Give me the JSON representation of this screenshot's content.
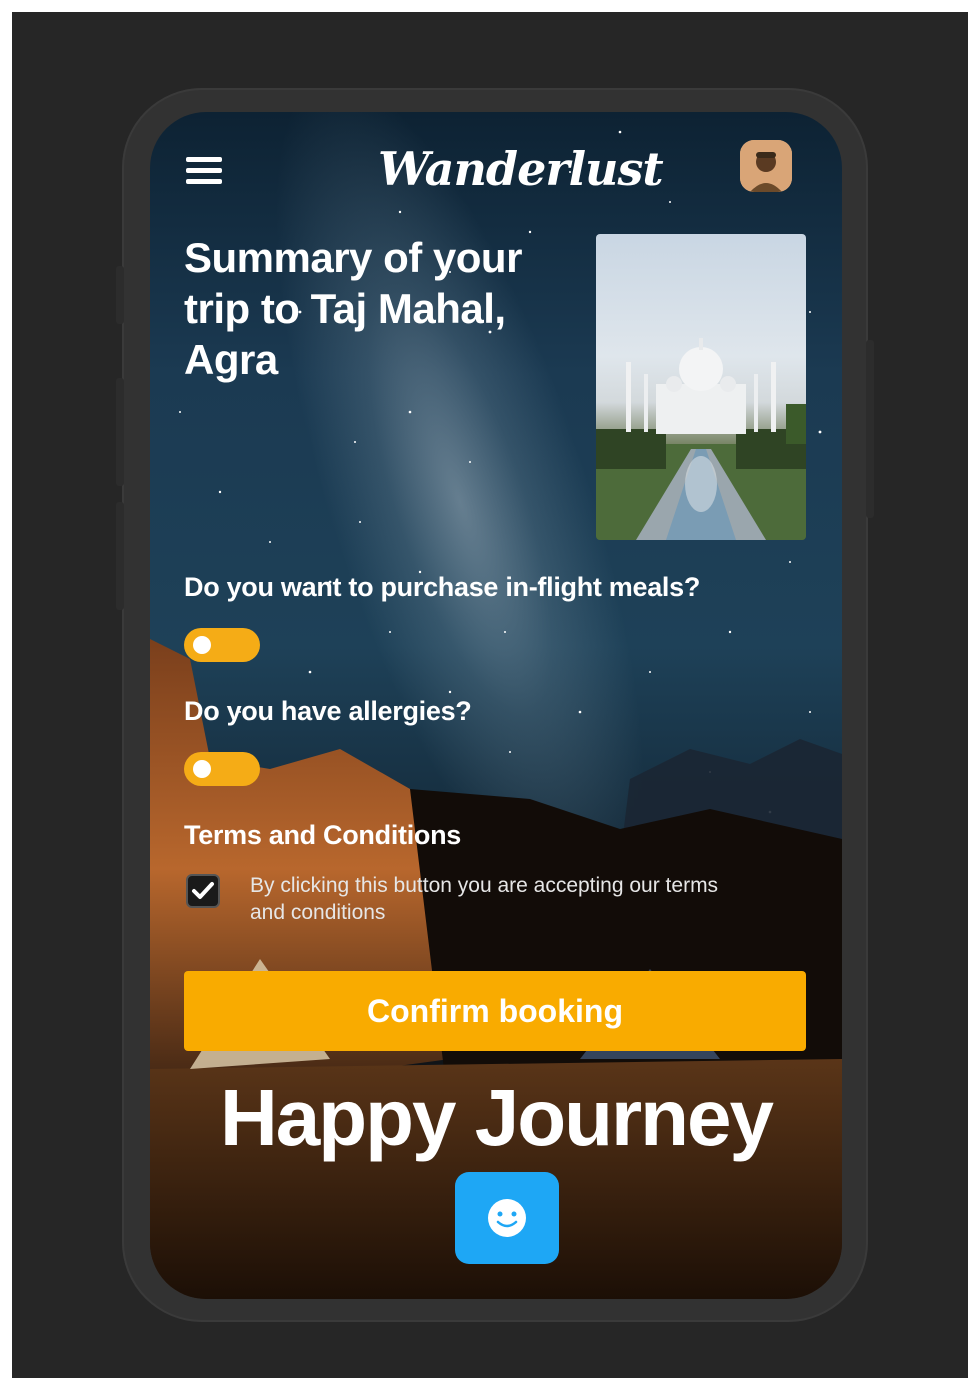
{
  "app": {
    "logo": "Wanderlust"
  },
  "header": {
    "menu_icon": "hamburger-icon",
    "avatar": "user-avatar"
  },
  "summary": {
    "title": "Summary of your trip to Taj Mahal, Agra"
  },
  "questions": [
    {
      "label": "Do you want to purchase in-flight meals?",
      "enabled": false
    },
    {
      "label": "Do you have allergies?",
      "enabled": false
    }
  ],
  "terms": {
    "heading": "Terms and Conditions",
    "text": "By clicking this button you are accepting our terms and conditions",
    "checked": true
  },
  "actions": {
    "confirm_label": "Confirm booking",
    "fab_icon": "smiley-icon"
  },
  "footer": {
    "message": "Happy Journey"
  },
  "colors": {
    "accent": "#f9ab00",
    "fab": "#1ea7f5",
    "background": "#262626"
  }
}
